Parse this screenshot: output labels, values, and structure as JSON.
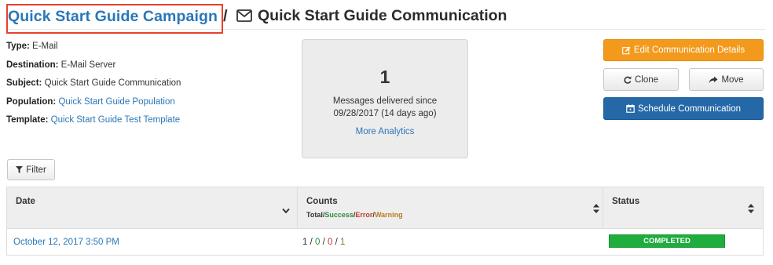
{
  "header": {
    "campaign_link": "Quick Start Guide Campaign",
    "separator": "/",
    "title": "Quick Start Guide Communication",
    "title_icon": "envelope-icon"
  },
  "details": {
    "type_label": "Type:",
    "type_value": "E-Mail",
    "destination_label": "Destination:",
    "destination_value": "E-Mail Server",
    "subject_label": "Subject:",
    "subject_value": "Quick Start Guide Communication",
    "population_label": "Population:",
    "population_value": "Quick Start Guide Population",
    "template_label": "Template:",
    "template_value": "Quick Start Guide Test Template"
  },
  "stats": {
    "count": "1",
    "line1": "Messages delivered since",
    "line2": "09/28/2017 (14 days ago)",
    "analytics_link": "More Analytics"
  },
  "actions": {
    "edit_label": "Edit Communication Details",
    "clone_label": "Clone",
    "move_label": "Move",
    "schedule_label": "Schedule Communication",
    "filter_label": "Filter"
  },
  "table": {
    "columns": {
      "date": "Date",
      "counts": "Counts",
      "counts_sub": {
        "total": "Total",
        "sep1": "/",
        "success": "Success",
        "sep2": "/",
        "error": "Error",
        "sep3": "/",
        "warning": "Warning"
      },
      "status": "Status"
    },
    "rows": [
      {
        "date": "October 12, 2017 3:50 PM",
        "total": "1",
        "sep1": " / ",
        "success": "0",
        "sep2": " / ",
        "error": "0",
        "sep3": " / ",
        "warning": "1",
        "status": "COMPLETED"
      }
    ]
  },
  "colors": {
    "link": "#2a77b8",
    "edit_button": "#f39a1c",
    "schedule_button": "#2468a8",
    "status_completed": "#1fad3e",
    "highlight_box": "#e8412f"
  }
}
